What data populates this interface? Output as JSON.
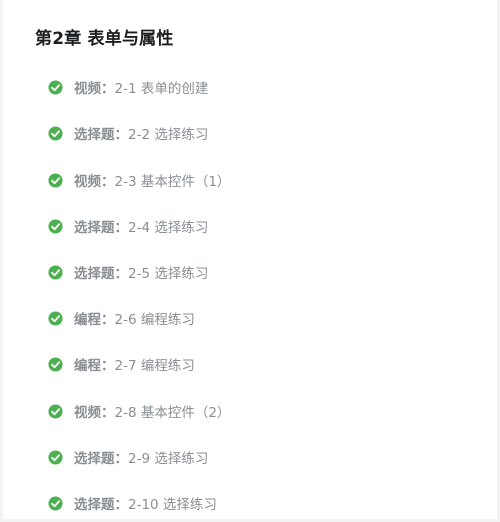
{
  "chapter": {
    "title": "第2章 表单与属性"
  },
  "colors": {
    "check": "#4caf50",
    "title_text": "#1c1f21",
    "item_text": "#8a8f94"
  },
  "lessons": [
    {
      "type": "视频：",
      "name": "2-1 表单的创建",
      "icon": "check-circle-icon",
      "completed": true
    },
    {
      "type": "选择题：",
      "name": "2-2 选择练习",
      "icon": "check-circle-icon",
      "completed": true
    },
    {
      "type": "视频：",
      "name": "2-3 基本控件（1）",
      "icon": "check-circle-icon",
      "completed": true
    },
    {
      "type": "选择题：",
      "name": "2-4 选择练习",
      "icon": "check-circle-icon",
      "completed": true
    },
    {
      "type": "选择题：",
      "name": "2-5 选择练习",
      "icon": "check-circle-icon",
      "completed": true
    },
    {
      "type": "编程：",
      "name": "2-6 编程练习",
      "icon": "check-circle-icon",
      "completed": true
    },
    {
      "type": "编程：",
      "name": "2-7 编程练习",
      "icon": "check-circle-icon",
      "completed": true
    },
    {
      "type": "视频：",
      "name": "2-8 基本控件（2）",
      "icon": "check-circle-icon",
      "completed": true
    },
    {
      "type": "选择题：",
      "name": "2-9 选择练习",
      "icon": "check-circle-icon",
      "completed": true
    },
    {
      "type": "选择题：",
      "name": "2-10 选择练习",
      "icon": "check-circle-icon",
      "completed": true
    }
  ]
}
